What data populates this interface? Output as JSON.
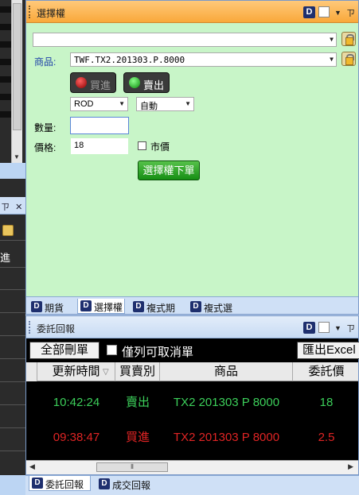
{
  "left_pane": {
    "header_pin": "ㄗ",
    "header_close": "✕",
    "visible_char": "進"
  },
  "top_panel": {
    "title": "選擇權",
    "row1": {
      "value": ""
    },
    "product": {
      "label": "商品:",
      "value": "TWF.TX2.201303.P.8000"
    },
    "buy_button": {
      "label": "買進"
    },
    "sell_button": {
      "label": "賣出"
    },
    "order_type": {
      "value": "ROD"
    },
    "price_mode": {
      "value": "自動"
    },
    "quantity": {
      "label": "數量:",
      "value": ""
    },
    "price": {
      "label": "價格:",
      "value": "18"
    },
    "market_price": {
      "label": "市價"
    },
    "submit_button": {
      "label": "選擇權下單"
    },
    "tabs": [
      {
        "label": "期貨"
      },
      {
        "label": "選擇權"
      },
      {
        "label": "複式期"
      },
      {
        "label": "複式選"
      }
    ]
  },
  "bottom_panel": {
    "title": "委託回報",
    "delete_all": "全部刪單",
    "only_cancelable": "僅列可取消單",
    "export": "匯出Excel",
    "columns": [
      "更新時間",
      "買賣別",
      "商品",
      "委託價"
    ],
    "rows": [
      {
        "time": "10:42:24",
        "side": "賣出",
        "product": "TX2 201303 P 8000",
        "price": "18",
        "color": "#3ccf5a"
      },
      {
        "time": "09:38:47",
        "side": "買進",
        "product": "TX2 201303 P 8000",
        "price": "2.5",
        "color": "#e02424"
      }
    ],
    "tabs": [
      {
        "label": "委託回報"
      },
      {
        "label": "成交回報"
      }
    ]
  },
  "colors": {
    "form_bg": "#c8f5c8",
    "title_orange": "#f9a83a",
    "sell_green": "#3ccf5a",
    "buy_red": "#e02424"
  }
}
